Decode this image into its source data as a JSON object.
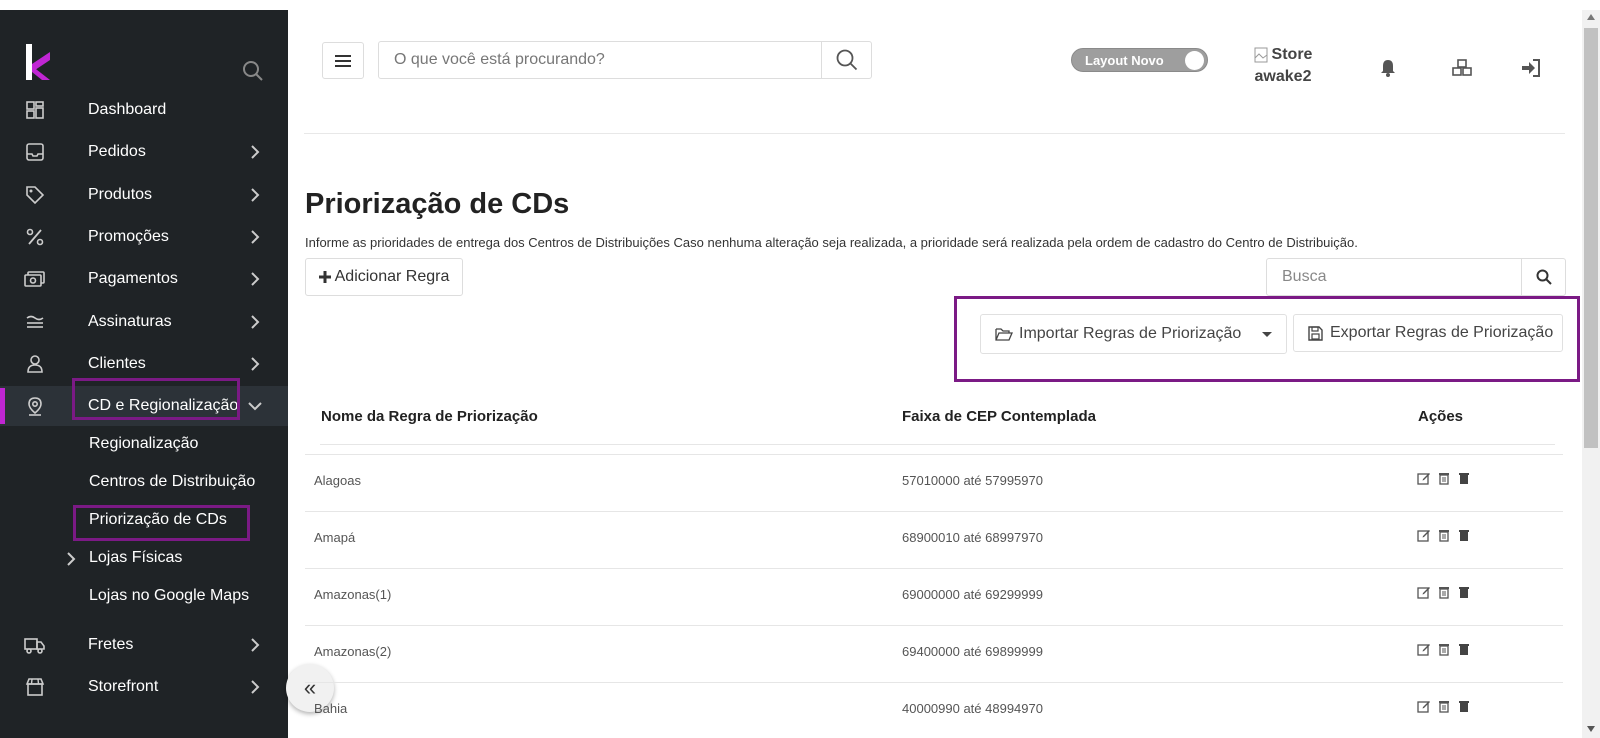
{
  "header": {
    "search_placeholder": "O que você está procurando?",
    "layout_toggle_label": "Layout Novo",
    "store_line1": "Store",
    "store_line2": "awake2"
  },
  "sidebar": {
    "items": [
      {
        "label": "Dashboard",
        "icon": "dashboard-icon"
      },
      {
        "label": "Pedidos",
        "icon": "inbox-icon"
      },
      {
        "label": "Produtos",
        "icon": "tag-icon"
      },
      {
        "label": "Promoções",
        "icon": "percent-icon"
      },
      {
        "label": "Pagamentos",
        "icon": "money-icon"
      },
      {
        "label": "Assinaturas",
        "icon": "waves-icon"
      },
      {
        "label": "Clientes",
        "icon": "user-icon"
      },
      {
        "label": "CD e Regionalização",
        "icon": "map-pin-icon"
      },
      {
        "label": "Fretes",
        "icon": "truck-icon"
      },
      {
        "label": "Storefront",
        "icon": "store-icon"
      }
    ],
    "sub_items": [
      {
        "label": "Regionalização"
      },
      {
        "label": "Centros de Distribuição"
      },
      {
        "label": "Priorização de CDs"
      },
      {
        "label": "Lojas Físicas"
      },
      {
        "label": "Lojas no Google Maps"
      }
    ],
    "collapse_glyph": "«"
  },
  "page": {
    "title": "Priorização de CDs",
    "description": "Informe as prioridades de entrega dos Centros de Distribuições Caso nenhuma alteração seja realizada, a prioridade será realizada pela ordem de cadastro do Centro de Distribuição.",
    "add_rule_label": "Adicionar Regra",
    "search_placeholder": "Busca",
    "import_label": "Importar Regras de Priorização",
    "export_label": "Exportar Regras de Priorização"
  },
  "table": {
    "headers": [
      "Nome da Regra de Priorização",
      "Faixa de CEP Contemplada",
      "Ações"
    ],
    "rows": [
      {
        "name": "Alagoas",
        "range": "57010000 até 57995970"
      },
      {
        "name": "Amapá",
        "range": "68900010 até 68997970"
      },
      {
        "name": "Amazonas(1)",
        "range": "69000000 até 69299999"
      },
      {
        "name": "Amazonas(2)",
        "range": "69400000 até 69899999"
      },
      {
        "name": "Bahia",
        "range": "40000990 até 48994970"
      }
    ]
  },
  "colors": {
    "sidebar_bg": "#1f2326",
    "accent": "#c026d3",
    "highlight_border": "#7b1a85"
  }
}
